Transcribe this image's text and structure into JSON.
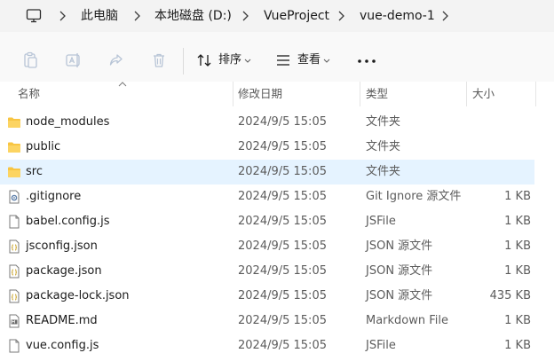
{
  "address": {
    "crumbs": [
      "此电脑",
      "本地磁盘 (D:)",
      "VueProject",
      "vue-demo-1"
    ]
  },
  "toolbar": {
    "sort_label": "排序",
    "view_label": "查看"
  },
  "columns": {
    "name": "名称",
    "modified": "修改日期",
    "type": "类型",
    "size": "大小"
  },
  "files": [
    {
      "name": "node_modules",
      "modified": "2024/9/5 15:05",
      "type": "文件夹",
      "size": "",
      "icon": "folder-icon"
    },
    {
      "name": "public",
      "modified": "2024/9/5 15:05",
      "type": "文件夹",
      "size": "",
      "icon": "folder-icon"
    },
    {
      "name": "src",
      "modified": "2024/9/5 15:05",
      "type": "文件夹",
      "size": "",
      "icon": "folder-icon",
      "selected": true
    },
    {
      "name": ".gitignore",
      "modified": "2024/9/5 15:05",
      "type": "Git Ignore 源文件",
      "size": "1 KB",
      "icon": "gear-file-icon"
    },
    {
      "name": "babel.config.js",
      "modified": "2024/9/5 15:05",
      "type": "JSFile",
      "size": "1 KB",
      "icon": "file-icon"
    },
    {
      "name": "jsconfig.json",
      "modified": "2024/9/5 15:05",
      "type": "JSON 源文件",
      "size": "1 KB",
      "icon": "json-file-icon"
    },
    {
      "name": "package.json",
      "modified": "2024/9/5 15:05",
      "type": "JSON 源文件",
      "size": "1 KB",
      "icon": "json-file-icon"
    },
    {
      "name": "package-lock.json",
      "modified": "2024/9/5 15:05",
      "type": "JSON 源文件",
      "size": "435 KB",
      "icon": "json-file-icon"
    },
    {
      "name": "README.md",
      "modified": "2024/9/5 15:05",
      "type": "Markdown File",
      "size": "1 KB",
      "icon": "markdown-file-icon"
    },
    {
      "name": "vue.config.js",
      "modified": "2024/9/5 15:05",
      "type": "JSFile",
      "size": "1 KB",
      "icon": "file-icon"
    }
  ],
  "colors": {
    "folder": "#f8c542",
    "selection": "#e5f3ff",
    "address_bg": "#f3f3f3"
  }
}
